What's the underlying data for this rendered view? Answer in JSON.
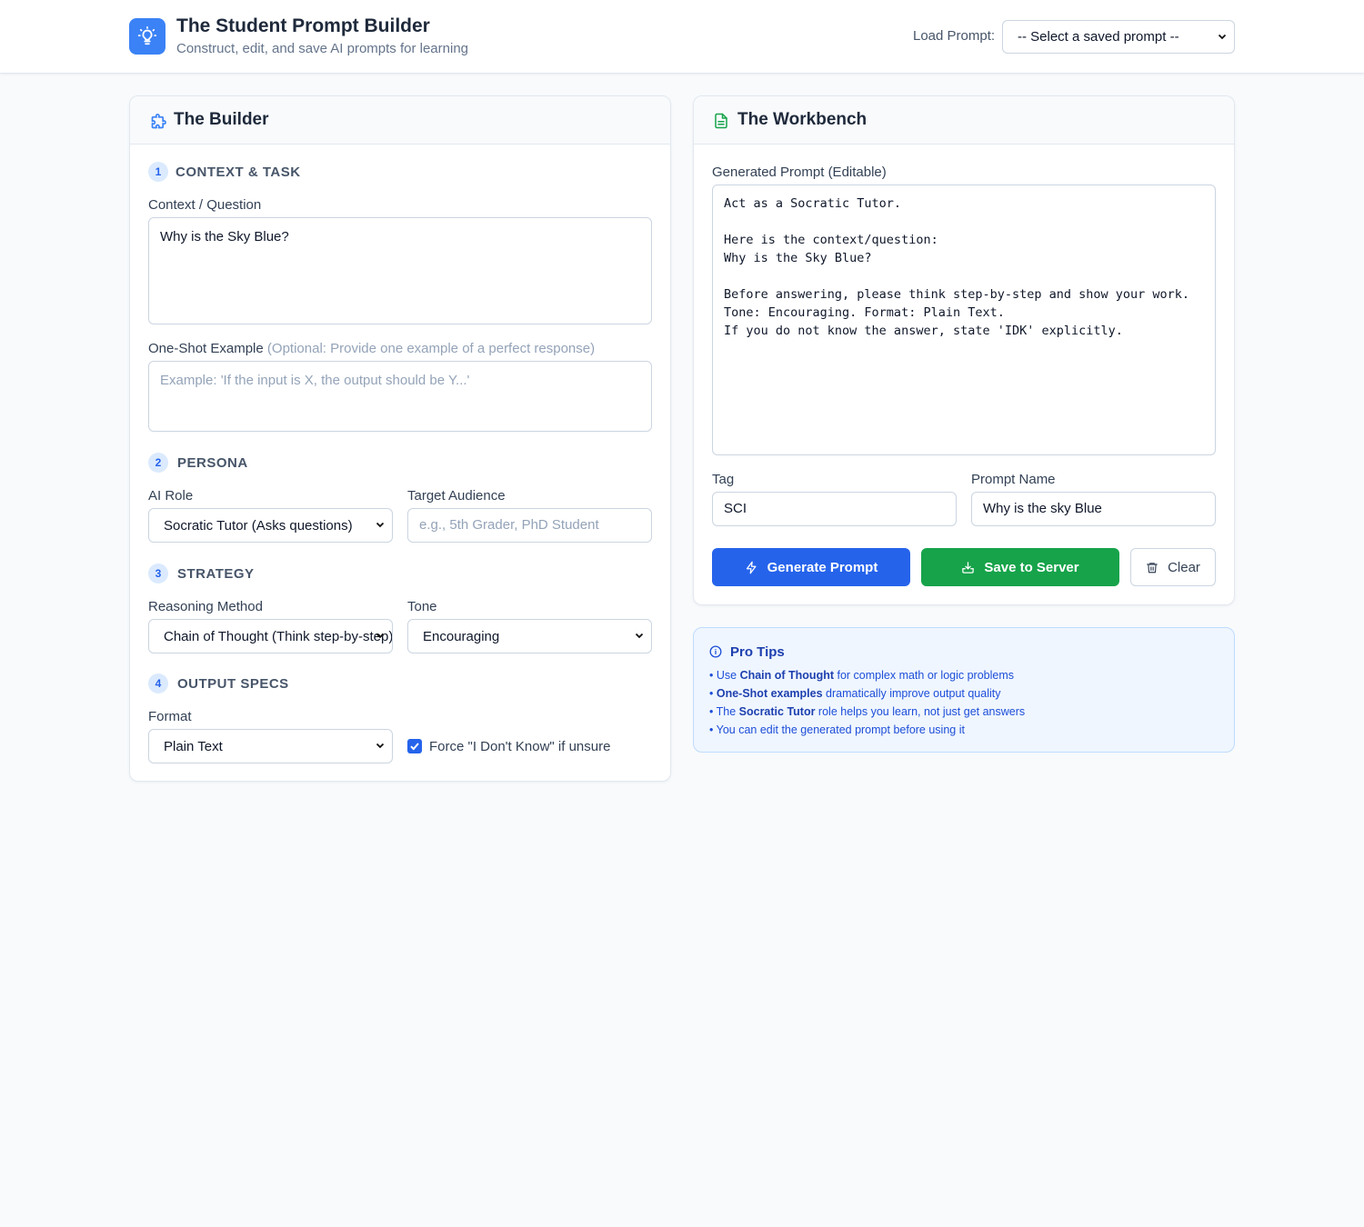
{
  "app": {
    "title": "The Student Prompt Builder",
    "subtitle": "Construct, edit, and save AI prompts for learning",
    "load_label": "Load Prompt:",
    "load_select_value": "-- Select a saved prompt --"
  },
  "builder": {
    "title": "The Builder",
    "sections": {
      "context": {
        "num": "1",
        "title": "CONTEXT & TASK"
      },
      "persona": {
        "num": "2",
        "title": "PERSONA"
      },
      "strategy": {
        "num": "3",
        "title": "STRATEGY"
      },
      "output": {
        "num": "4",
        "title": "OUTPUT SPECS"
      }
    },
    "context_label": "Context / Question",
    "context_value": "Why is the Sky Blue?",
    "oneshot_label": "One-Shot Example",
    "oneshot_hint": "(Optional: Provide one example of a perfect response)",
    "oneshot_placeholder": "Example: 'If the input is X, the output should be Y...'",
    "ai_role_label": "AI Role",
    "ai_role_value": "Socratic Tutor (Asks questions)",
    "audience_label": "Target Audience",
    "audience_placeholder": "e.g., 5th Grader, PhD Student",
    "reasoning_label": "Reasoning Method",
    "reasoning_value": "Chain of Thought (Think step-by-step)",
    "tone_label": "Tone",
    "tone_value": "Encouraging",
    "format_label": "Format",
    "format_value": "Plain Text",
    "idk_label": "Force \"I Don't Know\" if unsure",
    "idk_checked": true
  },
  "workbench": {
    "title": "The Workbench",
    "generated_label": "Generated Prompt (Editable)",
    "generated_text": "Act as a Socratic Tutor.\n\nHere is the context/question:\nWhy is the Sky Blue?\n\nBefore answering, please think step-by-step and show your work.\nTone: Encouraging. Format: Plain Text.\nIf you do not know the answer, state 'IDK' explicitly.",
    "tag_label": "Tag",
    "tag_value": "SCI",
    "name_label": "Prompt Name",
    "name_value": "Why is the sky Blue",
    "generate_button": "Generate Prompt",
    "save_button": "Save to Server",
    "clear_button": "Clear"
  },
  "tips": {
    "title": "Pro Tips",
    "items": [
      {
        "pre": "Use ",
        "bold": "Chain of Thought",
        "post": " for complex math or logic problems"
      },
      {
        "pre": "",
        "bold": "One-Shot examples",
        "post": " dramatically improve output quality"
      },
      {
        "pre": "The ",
        "bold": "Socratic Tutor",
        "post": " role helps you learn, not just get answers"
      },
      {
        "pre": "",
        "bold": "",
        "post": "You can edit the generated prompt before using it"
      }
    ]
  },
  "colors": {
    "primary": "#2563eb",
    "success": "#16a34a",
    "accent_blue": "#3b82f6"
  }
}
